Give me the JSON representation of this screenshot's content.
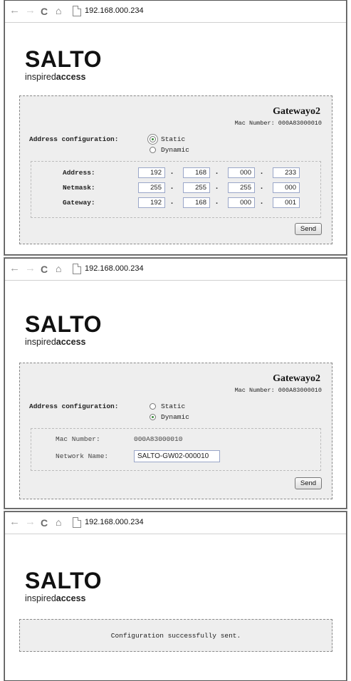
{
  "browser": {
    "back_icon": "←",
    "forward_icon": "→",
    "reload_icon": "C",
    "home_icon": "⌂",
    "url": "192.168.000.234"
  },
  "logo": {
    "word": "SALTO",
    "sub_light": "inspired",
    "sub_bold": "access"
  },
  "screen1": {
    "gateway_title": "Gatewayo2",
    "mac_line": "Mac Number: 000A83000010",
    "address_config_label": "Address configuration:",
    "static_label": "Static",
    "dynamic_label": "Dynamic",
    "selected": "static",
    "rows": [
      {
        "label": "Address:",
        "octets": [
          "192",
          "168",
          "000",
          "233"
        ]
      },
      {
        "label": "Netmask:",
        "octets": [
          "255",
          "255",
          "255",
          "000"
        ]
      },
      {
        "label": "Gateway:",
        "octets": [
          "192",
          "168",
          "000",
          "001"
        ]
      }
    ],
    "send_label": "Send"
  },
  "screen2": {
    "gateway_title": "Gatewayo2",
    "mac_line": "Mac Number: 000A83000010",
    "address_config_label": "Address configuration:",
    "static_label": "Static",
    "dynamic_label": "Dynamic",
    "selected": "dynamic",
    "mac_number_label": "Mac Number:",
    "mac_number_value": "000A83000010",
    "network_name_label": "Network Name:",
    "network_name_value": "SALTO-GW02-000010",
    "send_label": "Send"
  },
  "screen3": {
    "message": "Configuration successfully sent."
  }
}
